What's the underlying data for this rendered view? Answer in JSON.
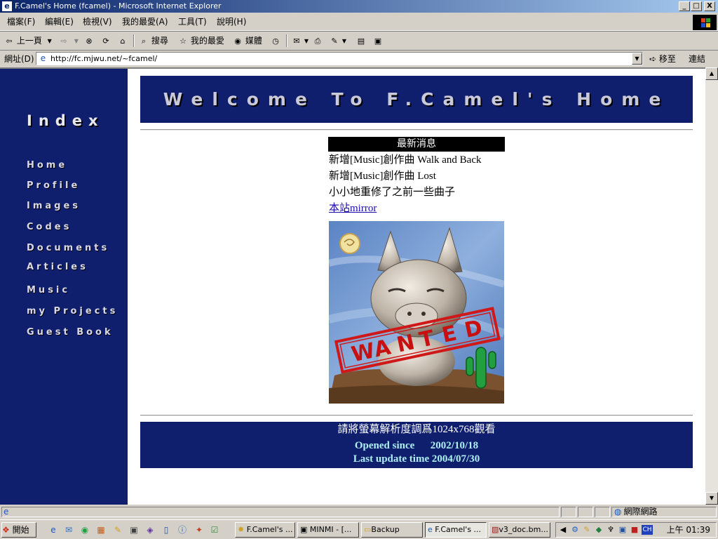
{
  "window": {
    "title": "F.Camel's Home (fcamel) - Microsoft Internet Explorer",
    "minimize": "_",
    "maximize": "□",
    "close": "X"
  },
  "menu": {
    "items": [
      "檔案(F)",
      "編輯(E)",
      "檢視(V)",
      "我的最愛(A)",
      "工具(T)",
      "說明(H)"
    ]
  },
  "toolbar": {
    "back_label": "上一頁",
    "search_label": "搜尋",
    "favorites_label": "我的最愛",
    "media_label": "媒體"
  },
  "address": {
    "label": "網址(D)",
    "url": "http://fc.mjwu.net/~fcamel/",
    "go_label": "移至",
    "links_label": "連結"
  },
  "site": {
    "banner": "Welcome To F.Camel's Home",
    "index_title": "Index",
    "nav": [
      "Home",
      "Profile",
      "Images",
      "Codes",
      "Documents",
      "Articles",
      "Music",
      "my Projects",
      "Guest Book"
    ],
    "news_title": "最新消息",
    "news": [
      "新增[Music]創作曲 Walk and Back",
      "新增[Music]創作曲 Lost",
      "小小地重修了之前一些曲子"
    ],
    "mirror_link": "本站mirror",
    "wanted_text": "WANTED",
    "footer": {
      "resolution_note": "請將螢幕解析度調爲1024x768觀看",
      "opened": "Opened since      2002/10/18",
      "updated": "Last update time 2004/07/30"
    }
  },
  "status": {
    "zone": "網際網路"
  },
  "taskbar": {
    "start_label": "開始",
    "tasks": [
      "F.Camel's ...",
      "MINMI - [...",
      "Backup",
      "F.Camel's ...",
      "v3_doc.bm..."
    ],
    "active_index": 3,
    "clock": "上午 01:39",
    "ime": "CH"
  },
  "colors": {
    "site_navy": "#0f1f6e",
    "link": "#1a0dab",
    "footer_cyan": "#aef0f0"
  }
}
